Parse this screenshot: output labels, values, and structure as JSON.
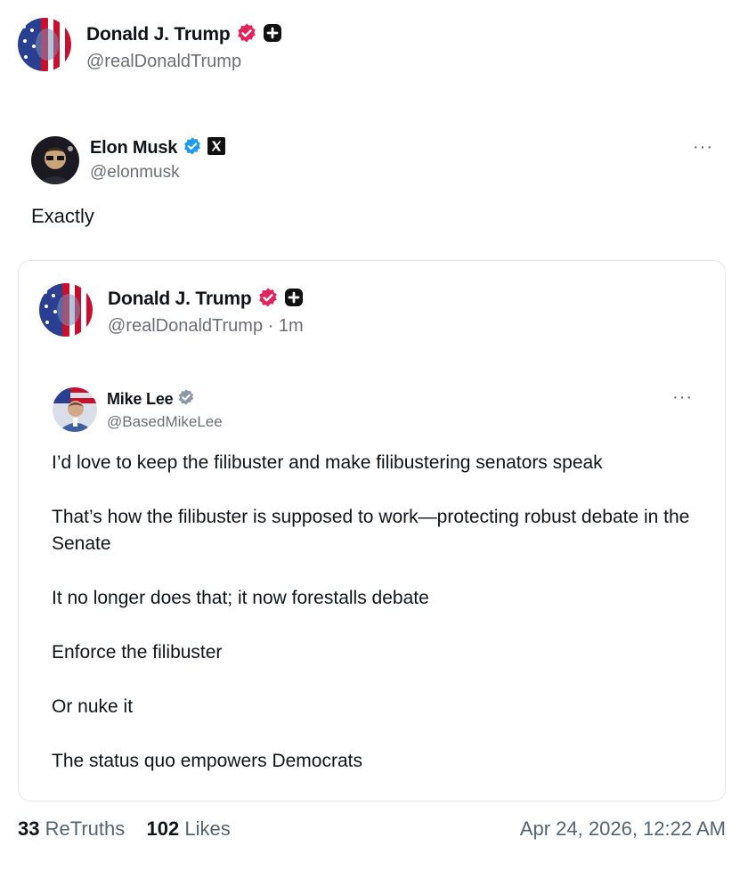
{
  "truth": {
    "author_name": "Donald J. Trump",
    "author_handle": "@realDonaldTrump",
    "verified_color": "#e0245e"
  },
  "x_post": {
    "author_name": "Elon Musk",
    "author_handle": "@elonmusk",
    "verified_color": "#1d9bf0",
    "text": "Exactly",
    "more_icon": "···"
  },
  "quoted_truth": {
    "author_name": "Donald J. Trump",
    "author_handle": "@realDonaldTrump · 1m",
    "nested_post": {
      "author_name": "Mike Lee",
      "author_handle": "@BasedMikeLee",
      "verified_color": "#8b98a5",
      "more_icon": "···",
      "paragraphs": [
        "I’d love to keep the filibuster and make filibustering senators speak",
        "That’s how the filibuster is supposed to work—protecting robust debate in the Senate",
        "It no longer does that; it now forestalls debate",
        "Enforce the filibuster",
        "Or nuke it",
        "The status quo empowers Democrats"
      ]
    }
  },
  "footer": {
    "retruths_count": "33",
    "retruths_label": "ReTruths",
    "likes_count": "102",
    "likes_label": "Likes",
    "timestamp": "Apr 24, 2026, 12:22 AM"
  }
}
